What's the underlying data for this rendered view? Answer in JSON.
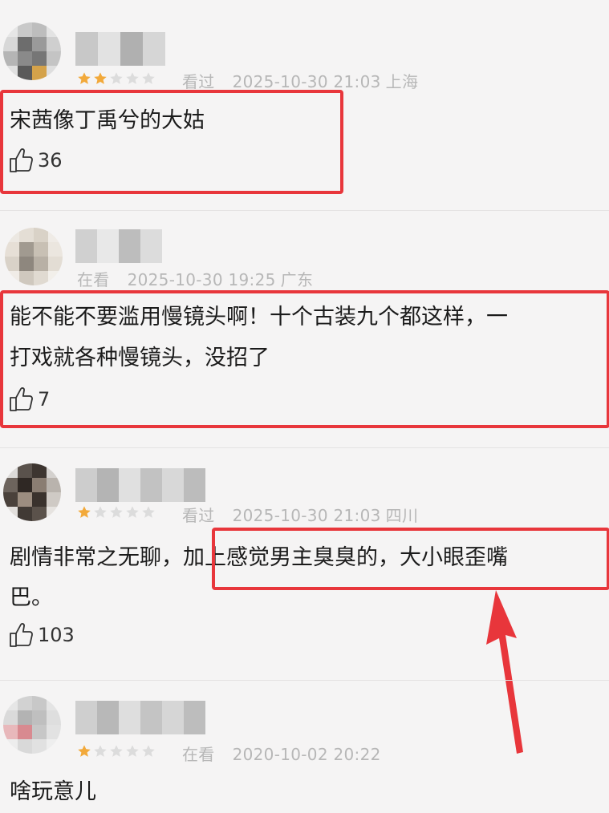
{
  "colors": {
    "background": "#f5f4f4",
    "highlight": "#e8363b",
    "star_on": "#f2a93a",
    "star_off": "#dcdcdc",
    "meta": "#b7b7b7"
  },
  "comments": [
    {
      "rating": 2,
      "status": "看过",
      "datetime": "2025-10-30 21:03",
      "location": "上海",
      "lines": [
        "宋茜像丁禹兮的大姑"
      ],
      "likes": "36",
      "like_icon": "thumbs-up-icon"
    },
    {
      "rating": 0,
      "status": "在看",
      "datetime": "2025-10-30 19:25",
      "location": "广东",
      "lines": [
        "能不能不要滥用慢镜头啊！十个古装九个都这样，一",
        "打戏就各种慢镜头，没招了"
      ],
      "likes": "7",
      "like_icon": "thumbs-up-icon"
    },
    {
      "rating": 1,
      "status": "看过",
      "datetime": "2025-10-30 21:03",
      "location": "四川",
      "lines": [
        "剧情非常之无聊，加上感觉男主臭臭的，大小眼歪嘴",
        "巴。"
      ],
      "likes": "103",
      "like_icon": "thumbs-up-icon"
    },
    {
      "rating": 1,
      "status": "在看",
      "datetime": "2020-10-02 20:22",
      "location": "",
      "lines": [
        "啥玩意儿"
      ]
    }
  ]
}
